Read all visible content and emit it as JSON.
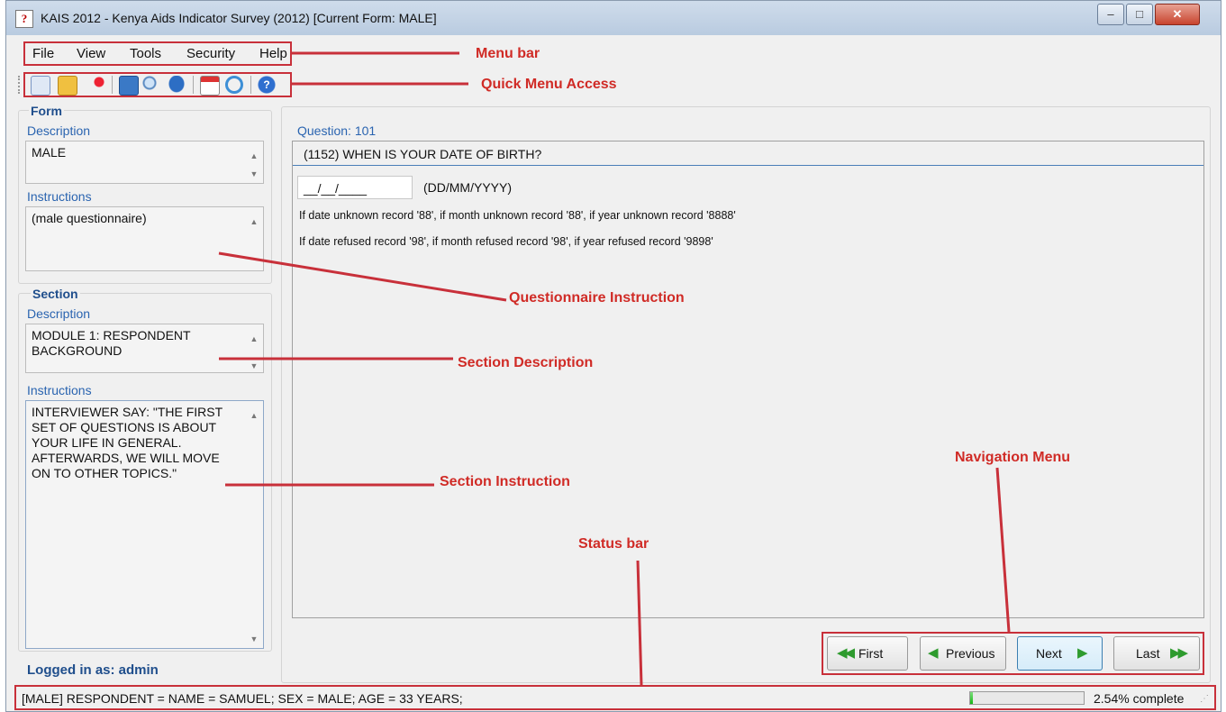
{
  "window": {
    "title": "KAIS 2012 - Kenya Aids Indicator Survey (2012) [Current Form: MALE]"
  },
  "menu": [
    "File",
    "View",
    "Tools",
    "Security",
    "Help"
  ],
  "toolbar": {
    "icons": [
      "new-form-icon",
      "open-folder-icon",
      "pin-icon",
      "save-icon",
      "search-icon",
      "comment-icon",
      "calendar-icon",
      "refresh-icon",
      "help-icon"
    ]
  },
  "form": {
    "group_title": "Form",
    "description_label": "Description",
    "description_value": "MALE",
    "instructions_label": "Instructions",
    "instructions_value": "(male questionnaire)"
  },
  "section": {
    "group_title": "Section",
    "description_label": "Description",
    "description_value": "MODULE 1: RESPONDENT BACKGROUND",
    "instructions_label": "Instructions",
    "instructions_value": "INTERVIEWER SAY: \"THE FIRST SET OF QUESTIONS IS ABOUT YOUR LIFE IN GENERAL. AFTERWARDS, WE WILL MOVE ON TO OTHER TOPICS.\""
  },
  "logged_in": "Logged in as: admin",
  "question": {
    "label": "Question: 101",
    "text": "(1152) WHEN IS YOUR DATE OF BIRTH?",
    "input_value": "__/__/____",
    "format": "(DD/MM/YYYY)",
    "notes": [
      "If date unknown record '88', if month unknown record '88', if year unknown record '8888'",
      "If date refused record '98', if month refused record '98', if year refused record '9898'"
    ]
  },
  "nav": {
    "first": "First",
    "previous": "Previous",
    "next": "Next",
    "last": "Last"
  },
  "status": {
    "text": "[MALE] RESPONDENT = NAME = SAMUEL; SEX = MALE; AGE = 33 YEARS;",
    "progress_fraction": 0.0254,
    "percent_text": "2.54% complete"
  },
  "annotations": {
    "menu_bar": "Menu bar",
    "quick_menu": "Quick Menu Access",
    "questionnaire_instruction": "Questionnaire Instruction",
    "section_description": "Section Description",
    "section_instruction": "Section Instruction",
    "navigation_menu": "Navigation Menu",
    "status_bar": "Status bar"
  },
  "colors": {
    "annotation": "#d02b26",
    "progress": "#16b816",
    "label_blue": "#2a64b0"
  }
}
